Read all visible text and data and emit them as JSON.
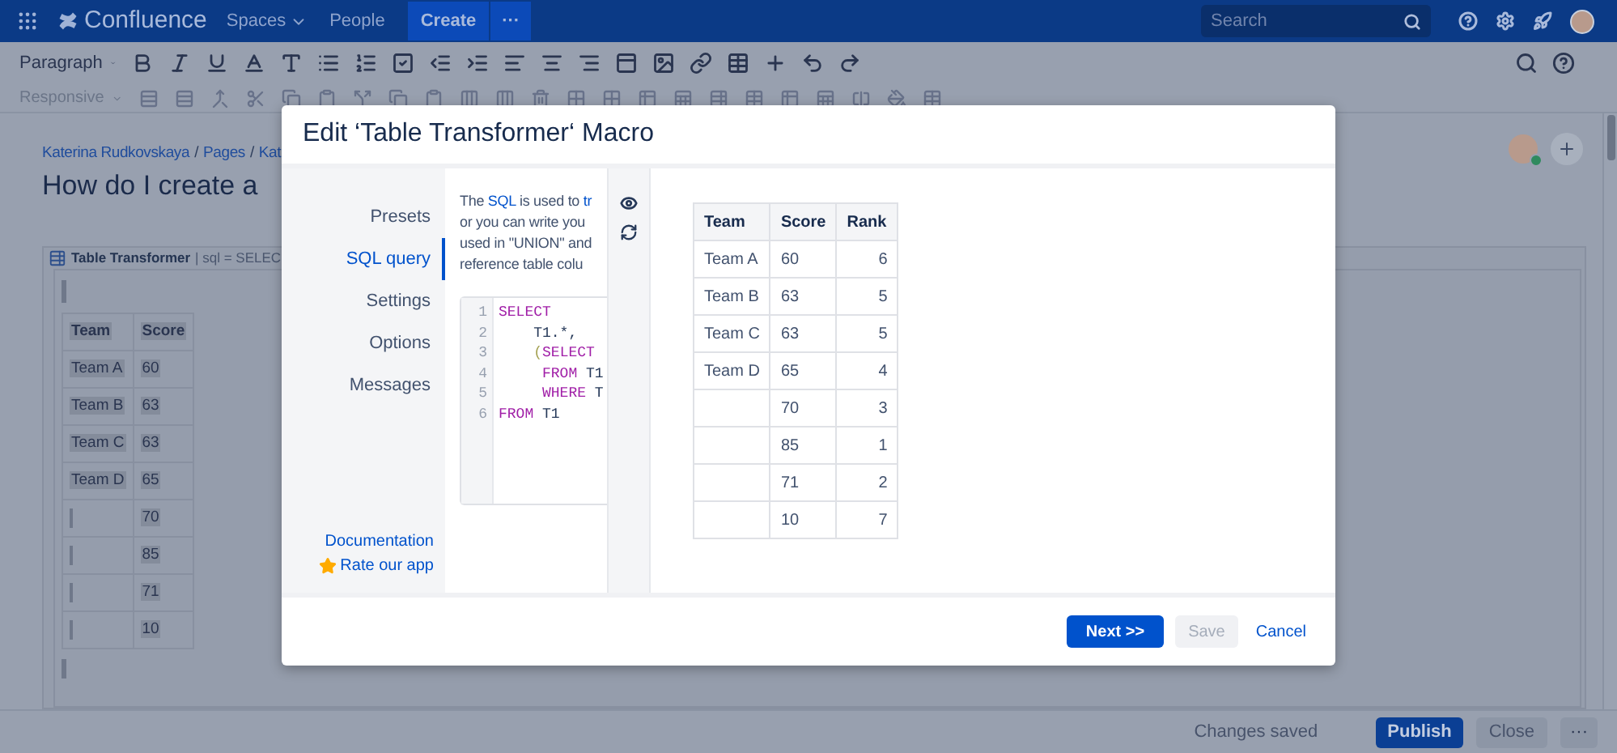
{
  "top_nav": {
    "product": "Confluence",
    "links": [
      {
        "label": "Spaces",
        "dropdown": true
      },
      {
        "label": "People",
        "dropdown": false
      }
    ],
    "create": "Create",
    "more": "···",
    "search": {
      "placeholder": "Search"
    }
  },
  "toolbar": {
    "paragraph": "Paragraph",
    "responsive": "Responsive"
  },
  "page": {
    "breadcrumbs": [
      {
        "text": "Katerina Rudkovskaya",
        "kind": "link"
      },
      {
        "text": "/",
        "kind": "separator"
      },
      {
        "text": "Pages",
        "kind": "link"
      },
      {
        "text": "/",
        "kind": "separator"
      },
      {
        "text": "Kat",
        "kind": "link"
      }
    ],
    "title": "How do I create a",
    "macro": {
      "name": "Table Transformer",
      "params": "| sql = SELEC",
      "columns": [
        "Team",
        "Score"
      ],
      "rows": [
        {
          "team": "Team A",
          "score": "60"
        },
        {
          "team": "Team B",
          "score": "63"
        },
        {
          "team": "Team C",
          "score": "63"
        },
        {
          "team": "Team D",
          "score": "65"
        },
        {
          "score": "70"
        },
        {
          "score": "85"
        },
        {
          "score": "71"
        },
        {
          "score": "10"
        }
      ]
    }
  },
  "modal": {
    "title": "Edit ‘Table Transformer‘ Macro",
    "nav": [
      {
        "label": "Presets",
        "selected": false
      },
      {
        "label": "SQL query",
        "selected": true
      },
      {
        "label": "Settings",
        "selected": false
      },
      {
        "label": "Options",
        "selected": false
      },
      {
        "label": "Messages",
        "selected": false
      }
    ],
    "documentation": "Documentation",
    "rate": "Rate our app",
    "description": [
      [
        {
          "text": "The ",
          "link": false
        },
        {
          "text": "SQL",
          "link": true
        },
        {
          "text": " is used to ",
          "link": false
        },
        {
          "text": "tr",
          "link": true
        }
      ],
      [
        {
          "text": "or you can write you",
          "link": false
        }
      ],
      [
        {
          "text": "used in \"UNION\" and",
          "link": false
        }
      ],
      [
        {
          "text": "reference table colu",
          "link": false
        }
      ]
    ],
    "code": [
      [
        {
          "text": "SELECT",
          "kind": "keyword"
        }
      ],
      [
        {
          "text": "    T1.*,",
          "kind": "plain"
        }
      ],
      [
        {
          "text": "    (",
          "kind": "paren"
        },
        {
          "text": "SELECT",
          "kind": "keyword"
        }
      ],
      [
        {
          "text": "     FROM",
          "kind": "keyword"
        },
        {
          "text": " T1",
          "kind": "plain"
        }
      ],
      [
        {
          "text": "     WHERE",
          "kind": "keyword"
        },
        {
          "text": " T",
          "kind": "plain"
        }
      ],
      [
        {
          "text": "FROM",
          "kind": "keyword"
        },
        {
          "text": " T1",
          "kind": "plain"
        }
      ]
    ],
    "code_line_numbers": [
      "1",
      "2",
      "3",
      "4",
      "5",
      "6"
    ],
    "preview": {
      "columns": [
        "Team",
        "Score",
        "Rank"
      ],
      "rows": [
        {
          "team": "Team A",
          "score": "60",
          "rank": "6"
        },
        {
          "team": "Team B",
          "score": "63",
          "rank": "5"
        },
        {
          "team": "Team C",
          "score": "63",
          "rank": "5"
        },
        {
          "team": "Team D",
          "score": "65",
          "rank": "4"
        },
        {
          "score": "70",
          "rank": "3"
        },
        {
          "score": "85",
          "rank": "1"
        },
        {
          "score": "71",
          "rank": "2"
        },
        {
          "score": "10",
          "rank": "7"
        }
      ]
    },
    "buttons": [
      {
        "label": "Next >>",
        "kind": "primary",
        "disabled": false
      },
      {
        "label": "Save",
        "kind": "default",
        "disabled": true
      },
      {
        "label": "Cancel",
        "kind": "link",
        "disabled": false
      }
    ]
  },
  "bottom_bar": {
    "status": "Changes saved",
    "publish": "Publish",
    "close": "Close",
    "more": "···"
  }
}
